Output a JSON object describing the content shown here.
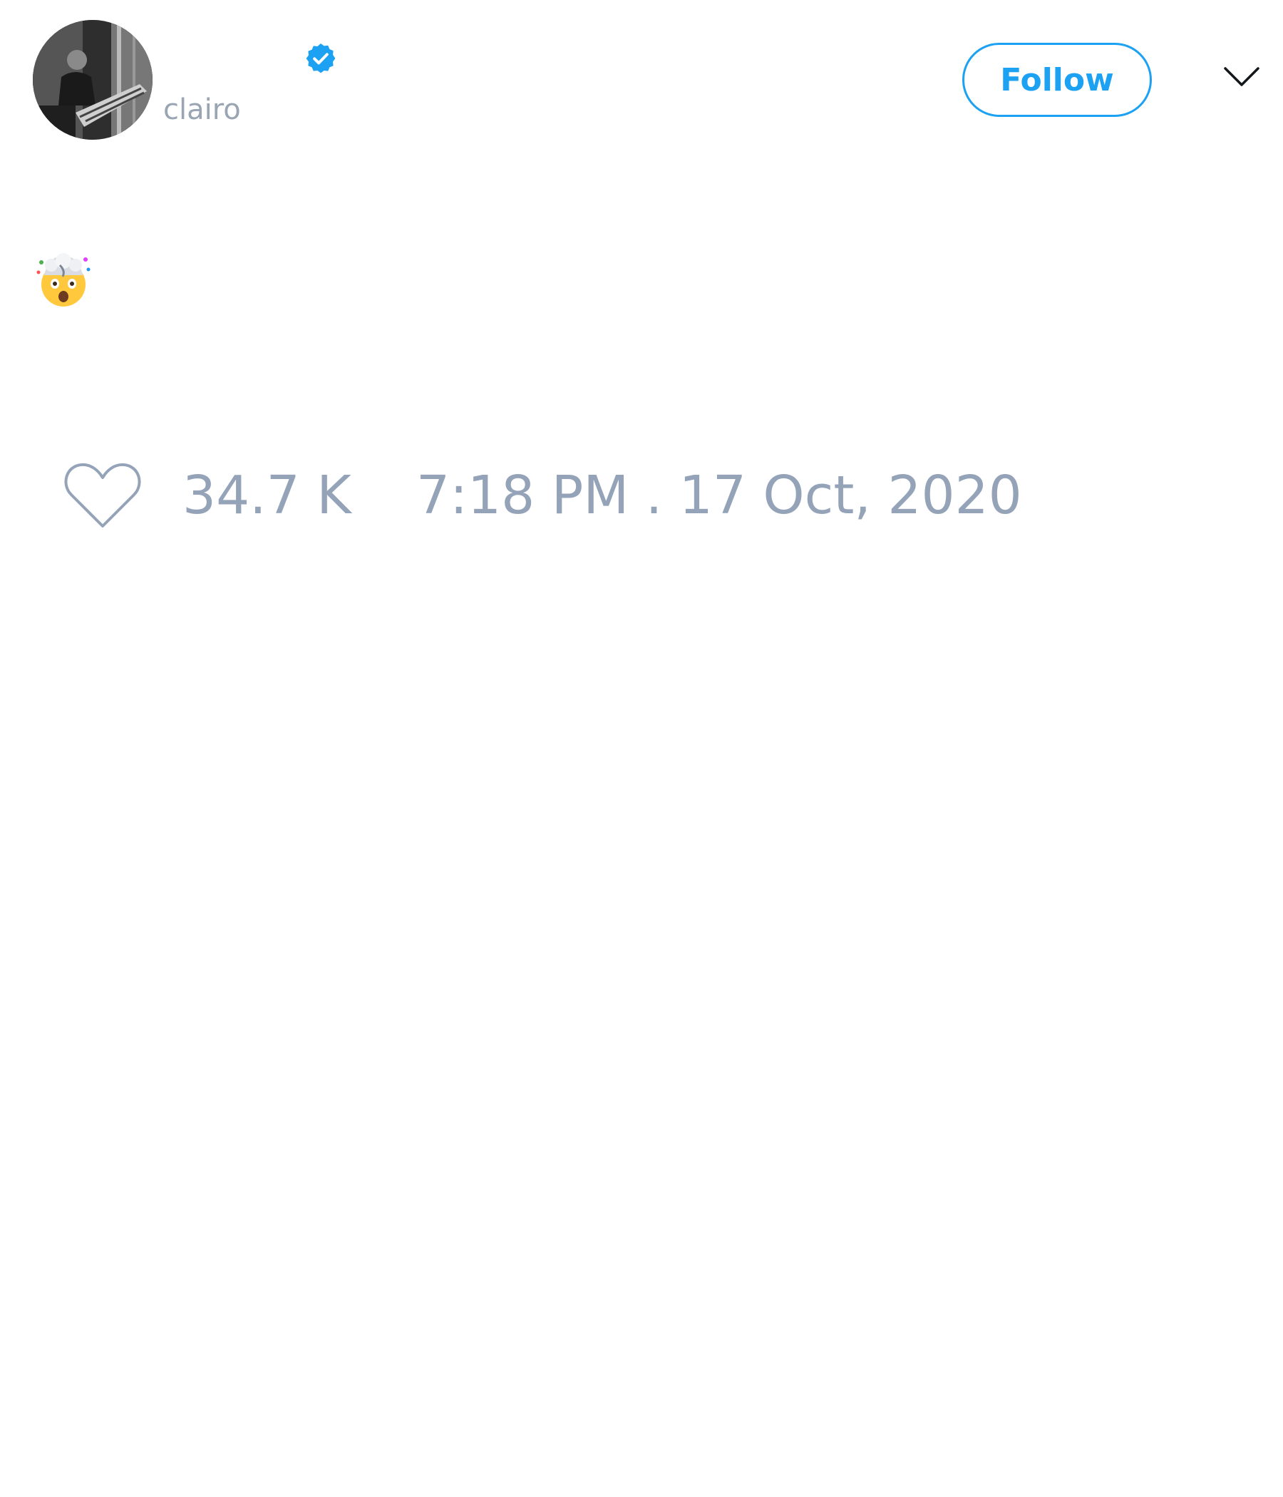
{
  "author": {
    "display_name": "",
    "handle": "clairo",
    "verified": true,
    "avatar_icon": "avatar-photo"
  },
  "actions": {
    "follow_label": "Follow",
    "menu_icon": "chevron-down-icon"
  },
  "tweet": {
    "text": "🤯"
  },
  "footer": {
    "like_icon": "heart-icon",
    "like_count": "34.7 K",
    "timestamp": "7:18 PM . 17 Oct, 2020"
  },
  "colors": {
    "accent": "#1da1f2",
    "muted_text": "#94a3b8",
    "handle_text": "#9aa5b4"
  }
}
